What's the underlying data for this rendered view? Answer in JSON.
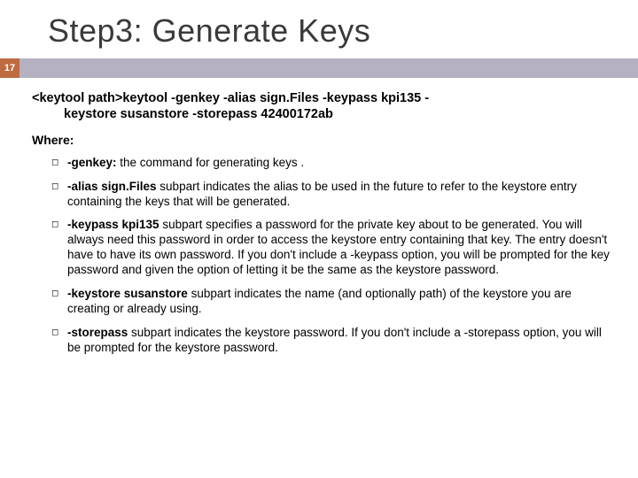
{
  "title": "Step3: Generate Keys",
  "pageNumber": "17",
  "commandLine1": "<keytool path>keytool -genkey -alias sign.Files -keypass kpi135 -",
  "commandLine2": "keystore susanstore -storepass 42400172ab",
  "whereLabel": "Where:",
  "bullets": [
    {
      "bold": "-genkey:",
      "text": " the command for generating keys ."
    },
    {
      "bold": "-alias sign.Files",
      "text": " subpart indicates the alias to be used in the future to refer to the keystore entry containing the keys that will be generated."
    },
    {
      "bold": "-keypass kpi135",
      "text": " subpart specifies a password for the private key about to be generated. You will always need this password in order to access the keystore entry containing that key. The entry doesn't have to have its own password. If you don't include a -keypass option, you will be prompted for the key password and given the option of letting it be the same as the keystore password."
    },
    {
      "bold": "-keystore susanstore",
      "text": " subpart indicates the name (and optionally path) of the keystore you are creating or already using."
    },
    {
      "bold": "-storepass",
      "text": " subpart indicates the keystore password. If you don't include a -storepass option, you will be prompted for the keystore password."
    }
  ]
}
